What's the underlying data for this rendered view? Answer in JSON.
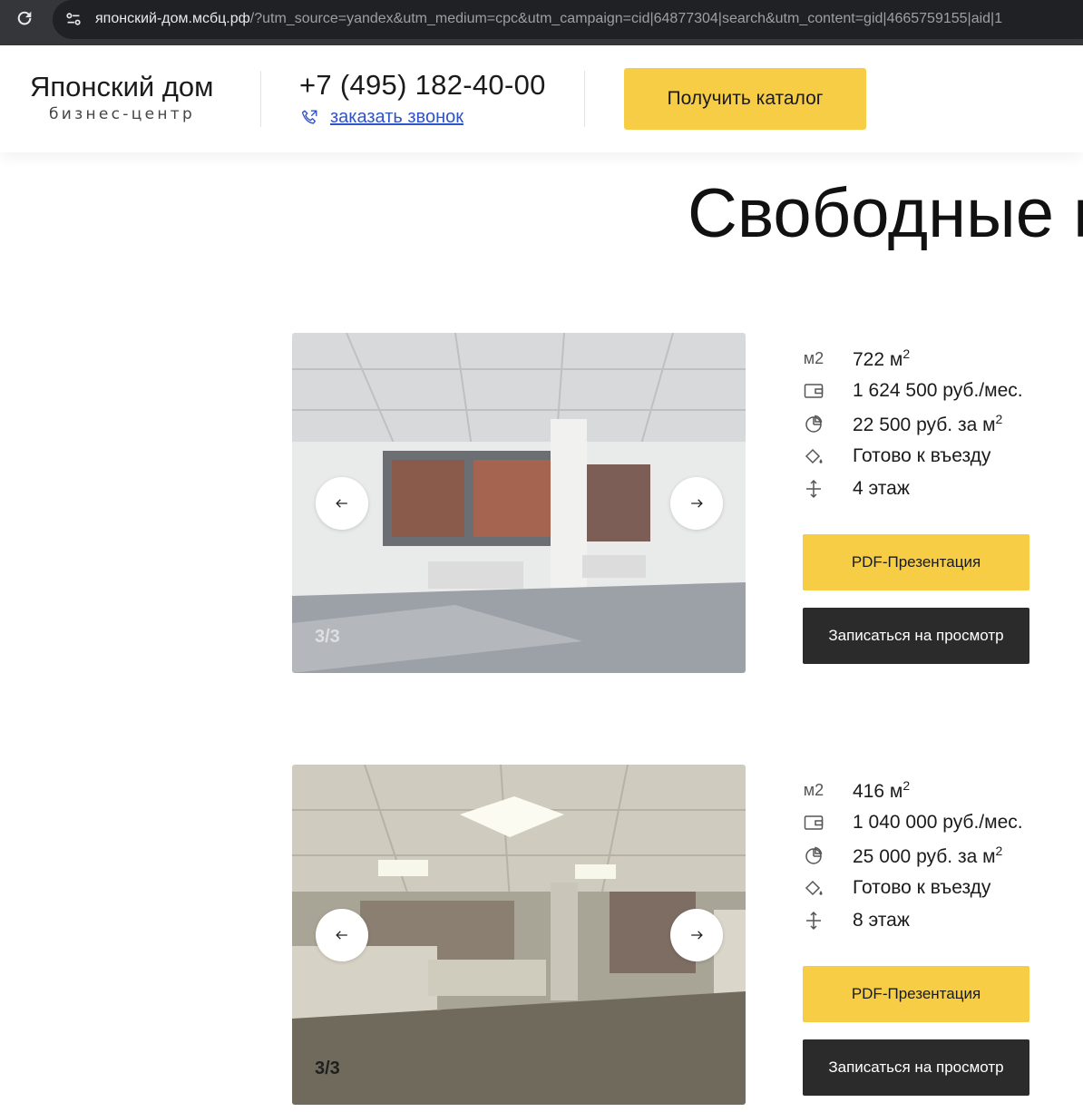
{
  "browser": {
    "url_host": "японский-дом.мсбц.рф",
    "url_rest": "/?utm_source=yandex&utm_medium=cpc&utm_campaign=cid|64877304|search&utm_content=gid|4665759155|aid|1"
  },
  "header": {
    "logo_title": "Японский дом",
    "logo_subtitle": "бизнес-центр",
    "phone": "+7 (495) 182-40-00",
    "callback_link": "заказать звонок",
    "catalog_button": "Получить каталог"
  },
  "main": {
    "title": "Свободные п",
    "offers": [
      {
        "area_label": "м2",
        "area_value": "722 м",
        "area_sup": "2",
        "price_month": "1 624 500 руб./мес.",
        "price_sqm": "22 500 руб. за м",
        "price_sqm_sup": "2",
        "status": "Готово к въезду",
        "floor": "4 этаж",
        "counter": "3/3",
        "pdf_button": "PDF-Презентация",
        "view_button": "Записаться на просмотр"
      },
      {
        "area_label": "м2",
        "area_value": "416 м",
        "area_sup": "2",
        "price_month": "1 040 000 руб./мес.",
        "price_sqm": "25 000 руб. за м",
        "price_sqm_sup": "2",
        "status": "Готово к въезду",
        "floor": "8 этаж",
        "counter": "3/3",
        "pdf_button": "PDF-Презентация",
        "view_button": "Записаться на просмотр"
      }
    ]
  },
  "icons": {
    "reload": "reload-icon",
    "site_info": "site-info-icon",
    "phone": "phone-callback-icon",
    "wallet": "wallet-icon",
    "pie": "pie-chart-icon",
    "ready": "paint-bucket-icon",
    "floor": "floor-height-icon",
    "prev": "arrow-left-icon",
    "next": "arrow-right-icon"
  },
  "colors": {
    "accent": "#f6cd44",
    "dark_button": "#2b2b2b",
    "link": "#2f54c8",
    "chrome": "#35363a"
  }
}
